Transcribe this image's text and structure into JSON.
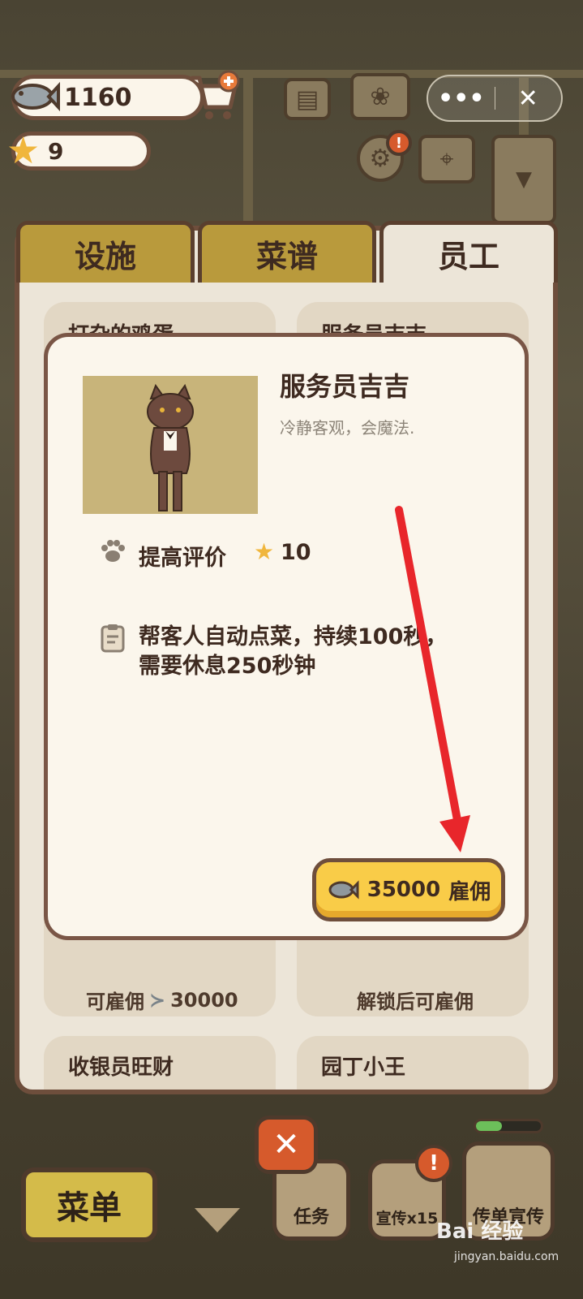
{
  "top_bar": {
    "fish_count": "1160",
    "star_count": "9",
    "capsule_more": "•••",
    "capsule_close": "✕"
  },
  "tabs": [
    {
      "label": "设施",
      "active": false
    },
    {
      "label": "菜谱",
      "active": false
    },
    {
      "label": "员工",
      "active": true
    }
  ],
  "staff_cards": [
    {
      "title": "打杂的鸡蛋",
      "footer_prefix": "可雇佣",
      "footer_price": "30000"
    },
    {
      "title": "服务员吉吉",
      "footer": "解锁后可雇佣"
    },
    {
      "title": "收银员旺财"
    },
    {
      "title": "园丁小王"
    }
  ],
  "modal": {
    "name": "服务员吉吉",
    "description": "冷静客观，会魔法.",
    "stat_label": "提高评价",
    "stat_value": "10",
    "skill_line1": "帮客人自动点菜，持续100秒，",
    "skill_line2": "需要休息250秒钟",
    "hire_price": "35000",
    "hire_label": "雇佣"
  },
  "bottom_bar": {
    "menu_label": "菜单",
    "task_label": "任务",
    "promo_label": "宣传x15",
    "flyer_label": "传单宣传"
  },
  "watermark": {
    "brand": "Bai 经验",
    "url": "jingyan.baidu.com"
  },
  "colors": {
    "panel_border": "#6e4e3c",
    "tab_inactive": "#b99a3c",
    "hire_button": "#f9cc48",
    "arrow": "#e8262b",
    "star": "#f0b63c"
  }
}
